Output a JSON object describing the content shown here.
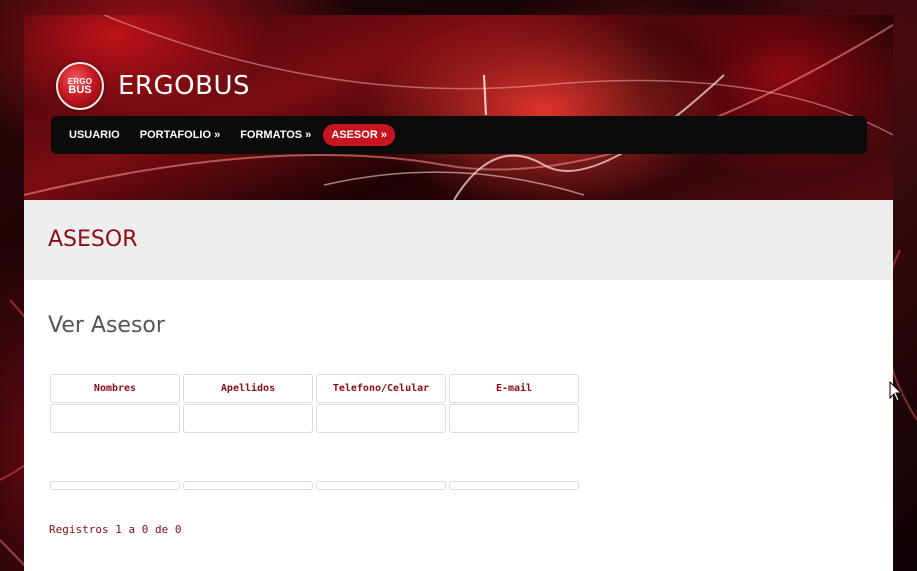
{
  "brand": {
    "logo_line1": "ERGO",
    "logo_line2": "BUS",
    "name": "ERGOBUS"
  },
  "nav": {
    "items": [
      {
        "label": "USUARIO"
      },
      {
        "label": "PORTAFOLIO »"
      },
      {
        "label": "FORMATOS »"
      },
      {
        "label": "ASESOR »"
      }
    ],
    "active_index": 3
  },
  "page": {
    "title": "ASESOR",
    "subtitle": "Ver Asesor"
  },
  "table": {
    "columns": [
      "Nombres",
      "Apellidos",
      "Telefono/Celular",
      "E-mail"
    ],
    "rows": []
  },
  "footer": {
    "records": "Registros 1 a 0 de 0"
  },
  "colors": {
    "accent": "#c8141e",
    "title_red": "#8a0e14",
    "nav_bg": "#0b0b0b",
    "band_bg": "#eeeeee"
  }
}
